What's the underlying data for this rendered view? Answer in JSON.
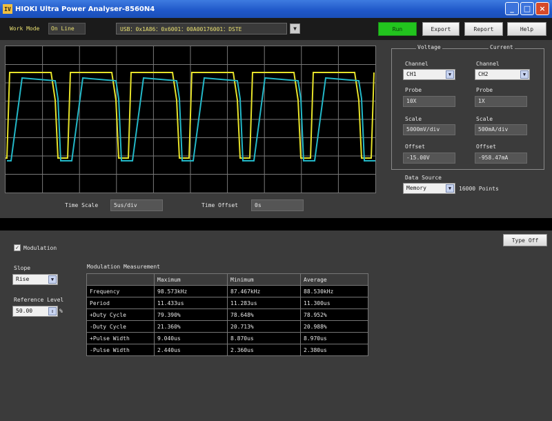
{
  "window": {
    "icon_text": "IV",
    "title": "HIOKI Ultra Power Analyser-8560N4",
    "min_glyph": "_",
    "max_glyph": "□",
    "close_glyph": "×"
  },
  "toolbar": {
    "mode_label": "Work Mode",
    "mode_value": "On Line",
    "device_info": "USB：0x1A86：0x6001：00A00176001：DSTE",
    "dropdown_glyph": "▼",
    "run_label": "Run",
    "export1_label": "Export",
    "export2_label": "Report",
    "help_label": "Help"
  },
  "scope": {
    "time_scale_label": "Time Scale",
    "time_scale_value": "5us/div",
    "time_offset_label": "Time Offset",
    "time_offset_value": "0s",
    "colors": {
      "ch_yellow": "#e6e22a",
      "ch_cyan": "#23b8c8",
      "grid": "#7a7a7a"
    }
  },
  "voltage": {
    "title": "Voltage",
    "channel_label": "Channel",
    "channel_value": "CH1",
    "probe_label": "Probe",
    "probe_value": "10X",
    "scale_label": "Scale",
    "scale_value": "5000mV/div",
    "offset_label": "Offset",
    "offset_value": "-15.00V"
  },
  "current": {
    "title": "Current",
    "channel_label": "Channel",
    "channel_value": "CH2",
    "probe_label": "Probe",
    "probe_value": "1X",
    "scale_label": "Scale",
    "scale_value": "500mA/div",
    "offset_label": "Offset",
    "offset_value": "-958.47mA"
  },
  "data_source": {
    "label": "Data Source",
    "value": "Memory",
    "points": "16000 Points"
  },
  "lower": {
    "modulation_label": "Modulation",
    "modulation_checked": "✓",
    "type_button": "Type Off",
    "slope_label": "Slope",
    "slope_value": "Rise",
    "ref_label": "Reference Level",
    "ref_value": "50.00",
    "ref_unit": "%",
    "meas_title": "Modulation Measurement"
  },
  "table": {
    "headers": [
      "",
      "Maximum",
      "Minimum",
      "Average"
    ],
    "rows": [
      [
        "Frequency",
        "98.573kHz",
        "87.467kHz",
        "88.530kHz"
      ],
      [
        "Period",
        "11.433us",
        "11.283us",
        "11.300us"
      ],
      [
        "+Duty Cycle",
        "79.390%",
        "78.648%",
        "78.952%"
      ],
      [
        "-Duty Cycle",
        "21.360%",
        "20.713%",
        "20.988%"
      ],
      [
        "+Pulse Width",
        "9.040us",
        "8.870us",
        "8.970us"
      ],
      [
        "-Pulse Width",
        "2.440us",
        "2.360us",
        "2.380us"
      ]
    ]
  }
}
